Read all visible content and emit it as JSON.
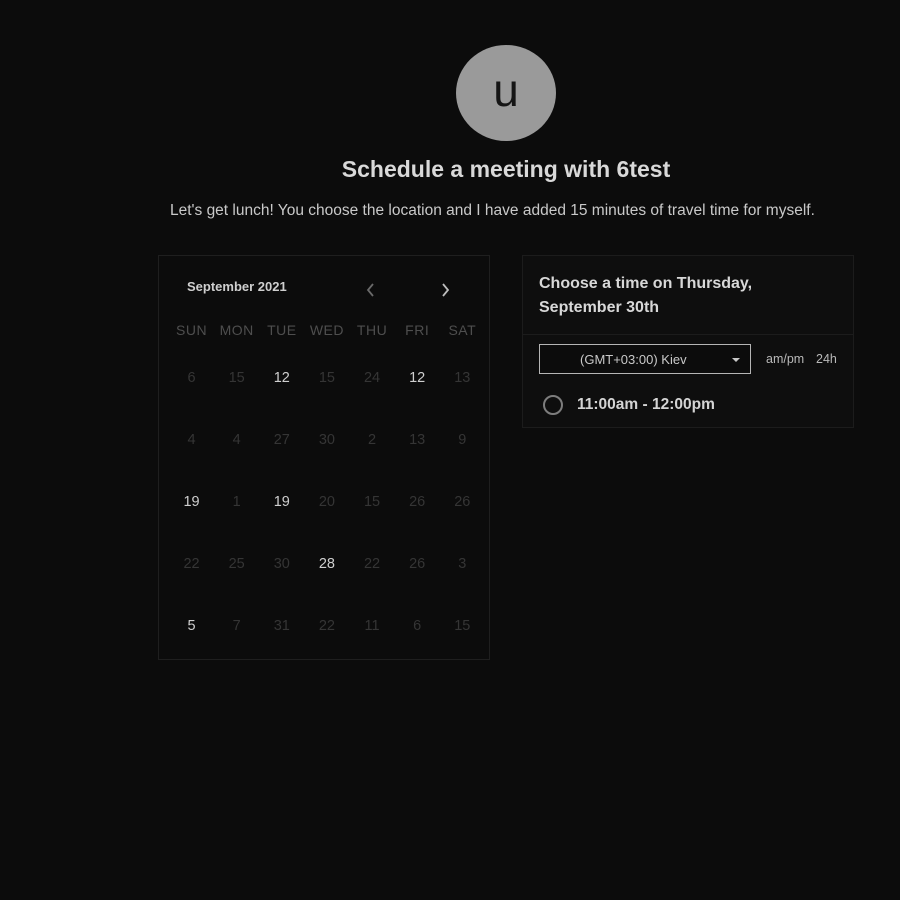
{
  "host": {
    "avatar_letter": "u",
    "title": "Schedule a meeting with 6test",
    "description": "Let's get lunch! You choose the location and I have added 15 minutes of travel time for myself."
  },
  "calendar": {
    "month_label": "September 2021",
    "weekdays": [
      "SUN",
      "MON",
      "TUE",
      "WED",
      "THU",
      "FRI",
      "SAT"
    ],
    "weeks": [
      [
        {
          "d": "6",
          "on": false
        },
        {
          "d": "15",
          "on": false
        },
        {
          "d": "12",
          "on": true
        },
        {
          "d": "15",
          "on": false
        },
        {
          "d": "24",
          "on": false
        },
        {
          "d": "12",
          "on": true
        },
        {
          "d": "13",
          "on": false
        }
      ],
      [
        {
          "d": "4",
          "on": false
        },
        {
          "d": "4",
          "on": false
        },
        {
          "d": "27",
          "on": false
        },
        {
          "d": "30",
          "on": false
        },
        {
          "d": "2",
          "on": false
        },
        {
          "d": "13",
          "on": false
        },
        {
          "d": "9",
          "on": false
        }
      ],
      [
        {
          "d": "19",
          "on": true
        },
        {
          "d": "1",
          "on": false
        },
        {
          "d": "19",
          "on": true
        },
        {
          "d": "20",
          "on": false
        },
        {
          "d": "15",
          "on": false
        },
        {
          "d": "26",
          "on": false
        },
        {
          "d": "26",
          "on": false
        }
      ],
      [
        {
          "d": "22",
          "on": false
        },
        {
          "d": "25",
          "on": false
        },
        {
          "d": "30",
          "on": false
        },
        {
          "d": "28",
          "on": true
        },
        {
          "d": "22",
          "on": false
        },
        {
          "d": "26",
          "on": false
        },
        {
          "d": "3",
          "on": false
        }
      ],
      [
        {
          "d": "5",
          "on": true
        },
        {
          "d": "7",
          "on": false
        },
        {
          "d": "31",
          "on": false
        },
        {
          "d": "22",
          "on": false
        },
        {
          "d": "11",
          "on": false
        },
        {
          "d": "6",
          "on": false
        },
        {
          "d": "15",
          "on": false
        }
      ]
    ],
    "prev_icon": "chevron-left-icon",
    "next_icon": "chevron-right-icon"
  },
  "time_panel": {
    "title": "Choose a time on Thursday, September 30th",
    "timezone": "(GMT+03:00) Kiev",
    "format_ampm": "am/pm",
    "format_24h": "24h",
    "slots": [
      "11:00am - 12:00pm"
    ]
  }
}
